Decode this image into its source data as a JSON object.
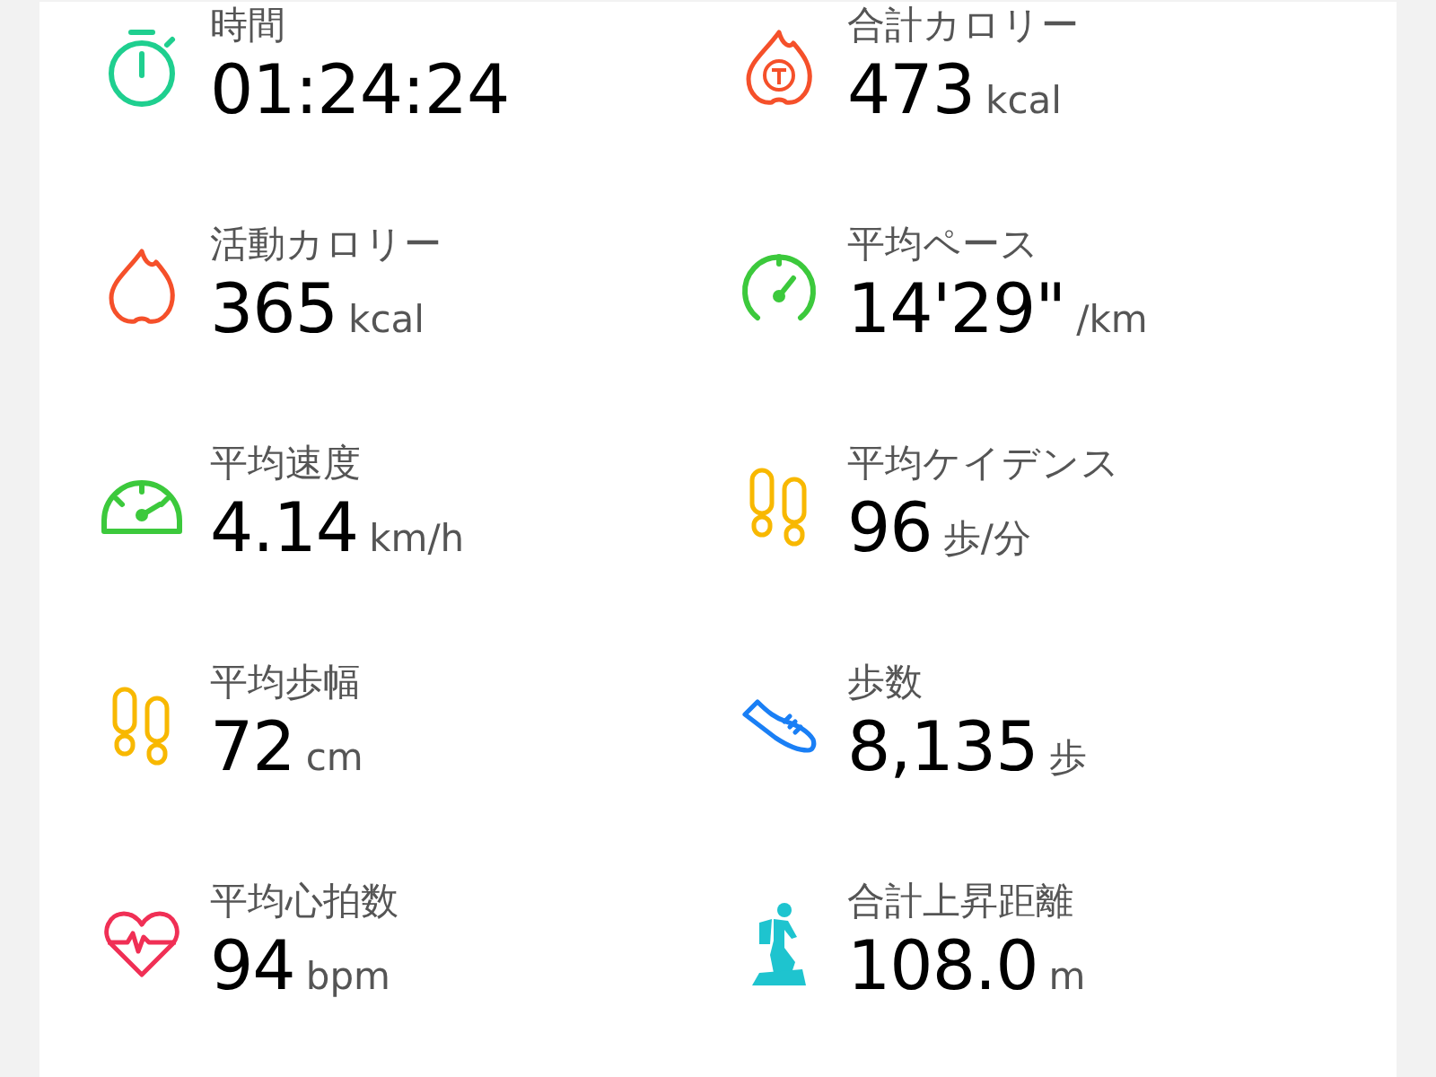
{
  "metrics": [
    {
      "kind": "stopwatch",
      "label": "時間",
      "value": "01:24:24"
    },
    {
      "kind": "total-flame",
      "label": "合計カロリー",
      "value": "473",
      "unit": "kcal"
    },
    {
      "kind": "flame",
      "label": "活動カロリー",
      "value": "365",
      "unit": "kcal"
    },
    {
      "kind": "pace",
      "label": "平均ペース",
      "value": "14'29\"",
      "unit": "/km"
    },
    {
      "kind": "speed",
      "label": "平均速度",
      "value": "4.14",
      "unit": "km/h"
    },
    {
      "kind": "cadence",
      "label": "平均ケイデンス",
      "value": "96",
      "unit": "歩/分"
    },
    {
      "kind": "stride",
      "label": "平均歩幅",
      "value": "72",
      "unit": "cm"
    },
    {
      "kind": "steps",
      "label": "歩数",
      "value": "8,135",
      "unit": "歩"
    },
    {
      "kind": "heart",
      "label": "平均心拍数",
      "value": "94",
      "unit": "bpm"
    },
    {
      "kind": "climb",
      "label": "合計上昇距離",
      "value": "108.0",
      "unit": "m"
    }
  ]
}
